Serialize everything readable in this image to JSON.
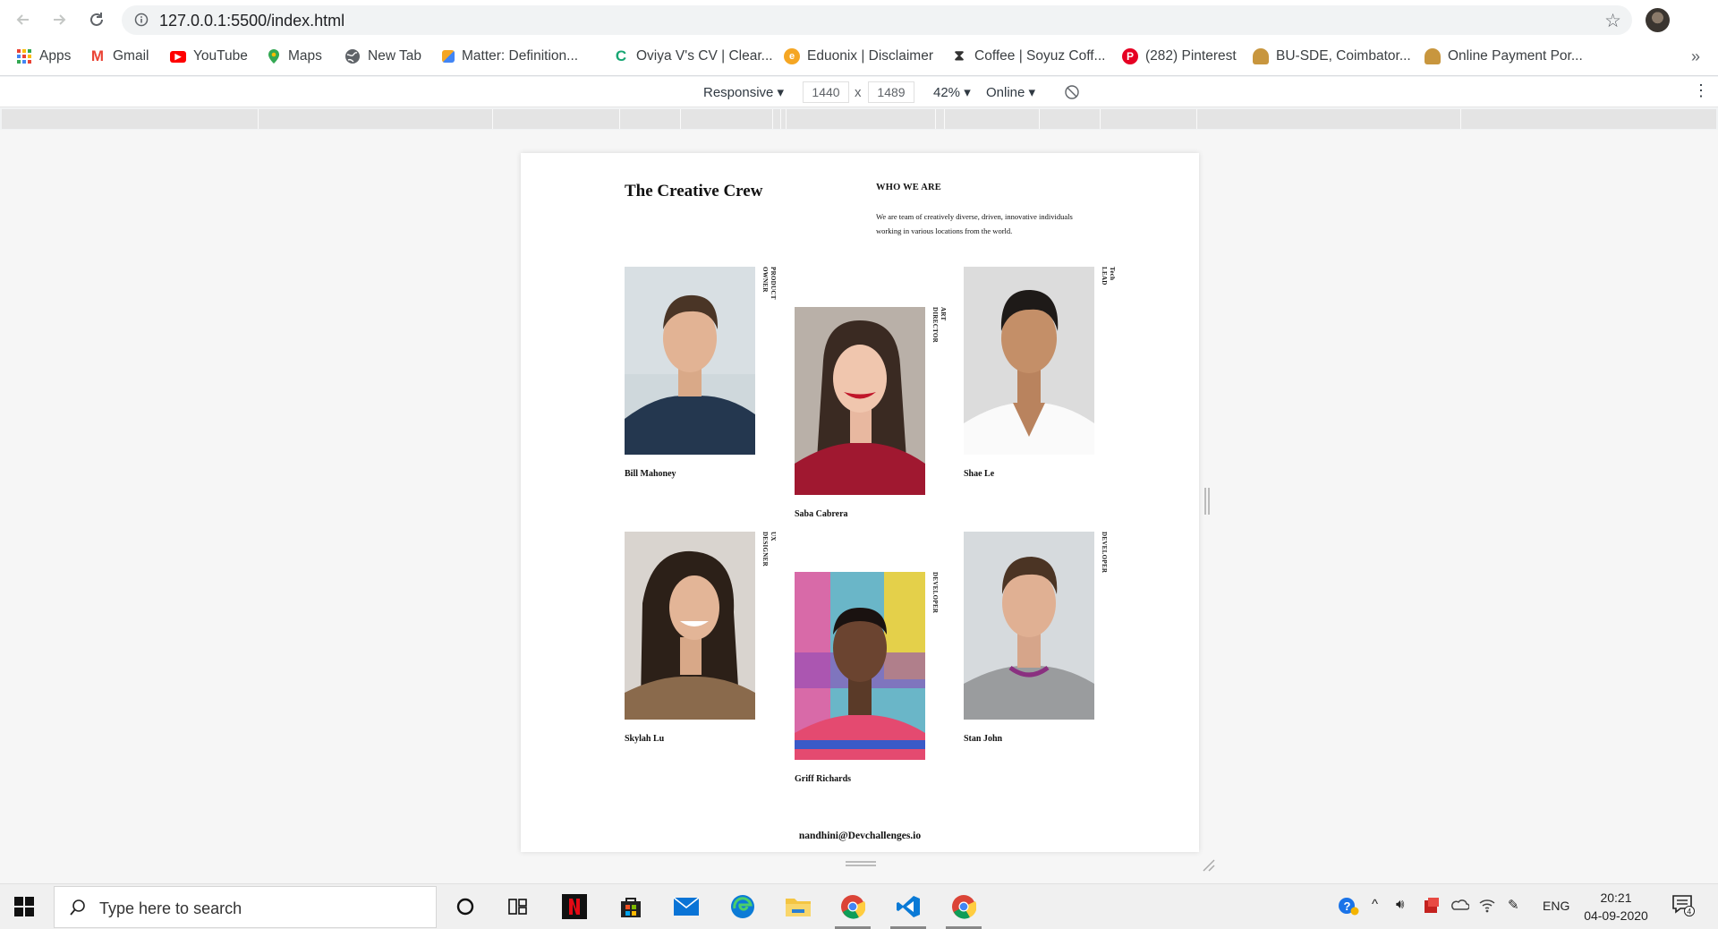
{
  "browser": {
    "url": "127.0.0.1:5500/index.html",
    "bookmarks": [
      {
        "label": "Apps",
        "icon": "apps-grid-icon",
        "color": "#ea4335"
      },
      {
        "label": "Gmail",
        "icon": "gmail-icon",
        "color": "#ea4335"
      },
      {
        "label": "YouTube",
        "icon": "youtube-icon",
        "color": "#ff0000"
      },
      {
        "label": "Maps",
        "icon": "maps-pin-icon",
        "color": "#34a853"
      },
      {
        "label": "New Tab",
        "icon": "globe-icon",
        "color": "#5f6368"
      },
      {
        "label": "Matter: Definition...",
        "icon": "matter-icon",
        "color": "#4285f4"
      },
      {
        "label": "Oviya V's CV | Clear...",
        "icon": "clearcv-icon",
        "color": "#17a673"
      },
      {
        "label": "Eduonix | Disclaimer",
        "icon": "eduonix-icon",
        "color": "#f5a623"
      },
      {
        "label": "Coffee | Soyuz Coff...",
        "icon": "coffee-icon",
        "color": "#333333"
      },
      {
        "label": "(282) Pinterest",
        "icon": "pinterest-icon",
        "color": "#e60023"
      },
      {
        "label": "BU-SDE, Coimbator...",
        "icon": "bu-icon",
        "color": "#c8963e"
      },
      {
        "label": "Online Payment Por...",
        "icon": "payment-icon",
        "color": "#c8963e"
      }
    ]
  },
  "devtools": {
    "device": "Responsive",
    "width": "1440",
    "times": "x",
    "height": "1489",
    "zoom": "42%",
    "network": "Online"
  },
  "page": {
    "title": "The Creative Crew",
    "who_heading": "WHO WE ARE",
    "who_text": "We are team of creatively diverse, driven, innovative individuals working in various locations from the world.",
    "members": [
      {
        "name": "Bill Mahoney",
        "role": "PRODUCT OWNER"
      },
      {
        "name": "Saba Cabrera",
        "role": "ART DIRECTOR"
      },
      {
        "name": "Shae Le",
        "role": "Tech LEAD"
      },
      {
        "name": "Skylah Lu",
        "role": "UX DESIGNER"
      },
      {
        "name": "Griff Richards",
        "role": "DEVELOPER"
      },
      {
        "name": "Stan John",
        "role": "DEVELOPER"
      }
    ],
    "footer_email": "nandhini@Devchallenges.io"
  },
  "taskbar": {
    "search_placeholder": "Type here to search",
    "language": "ENG",
    "time": "20:21",
    "date": "04-09-2020",
    "notification_count": "4"
  }
}
